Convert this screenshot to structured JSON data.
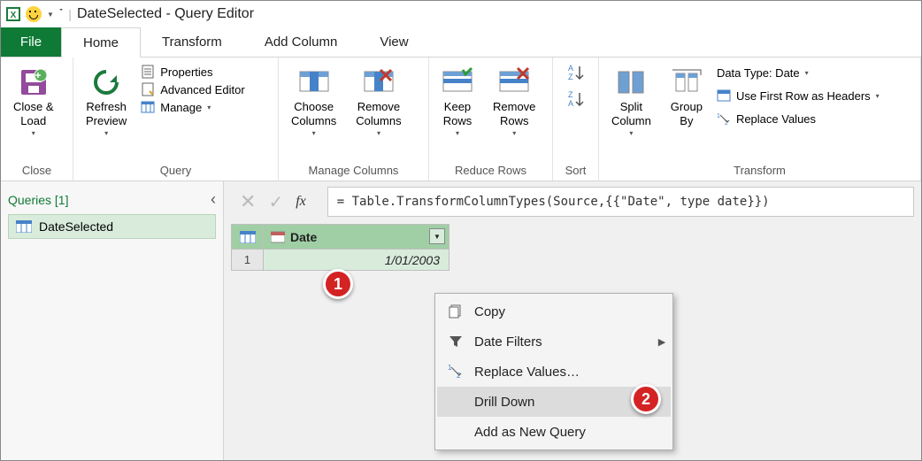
{
  "title": {
    "app": "DateSelected - Query Editor"
  },
  "menubar": {
    "file": "File",
    "home": "Home",
    "transform": "Transform",
    "addcol": "Add Column",
    "view": "View"
  },
  "ribbon": {
    "close": {
      "close_load": "Close &\nLoad",
      "group": "Close"
    },
    "query": {
      "refresh": "Refresh\nPreview",
      "properties": "Properties",
      "advanced": "Advanced Editor",
      "manage": "Manage",
      "group": "Query"
    },
    "cols": {
      "choose": "Choose\nColumns",
      "remove": "Remove\nColumns",
      "group": "Manage Columns"
    },
    "rows": {
      "keep": "Keep\nRows",
      "remove": "Remove\nRows",
      "group": "Reduce Rows"
    },
    "sort": {
      "group": "Sort"
    },
    "transform": {
      "split": "Split\nColumn",
      "groupby": "Group\nBy",
      "datatype": "Data Type: Date",
      "firstrow": "Use First Row as Headers",
      "replace": "Replace Values",
      "group": "Transform"
    }
  },
  "sidebar": {
    "header": "Queries [1]",
    "item": "DateSelected"
  },
  "formula": "= Table.TransformColumnTypes(Source,{{\"Date\", type date}})",
  "table": {
    "col": "Date",
    "row": "1",
    "value": "1/01/2003"
  },
  "context": {
    "copy": "Copy",
    "filters": "Date Filters",
    "replace": "Replace Values…",
    "drilldown": "Drill Down",
    "addquery": "Add as New Query"
  },
  "badges": {
    "b1": "1",
    "b2": "2"
  }
}
